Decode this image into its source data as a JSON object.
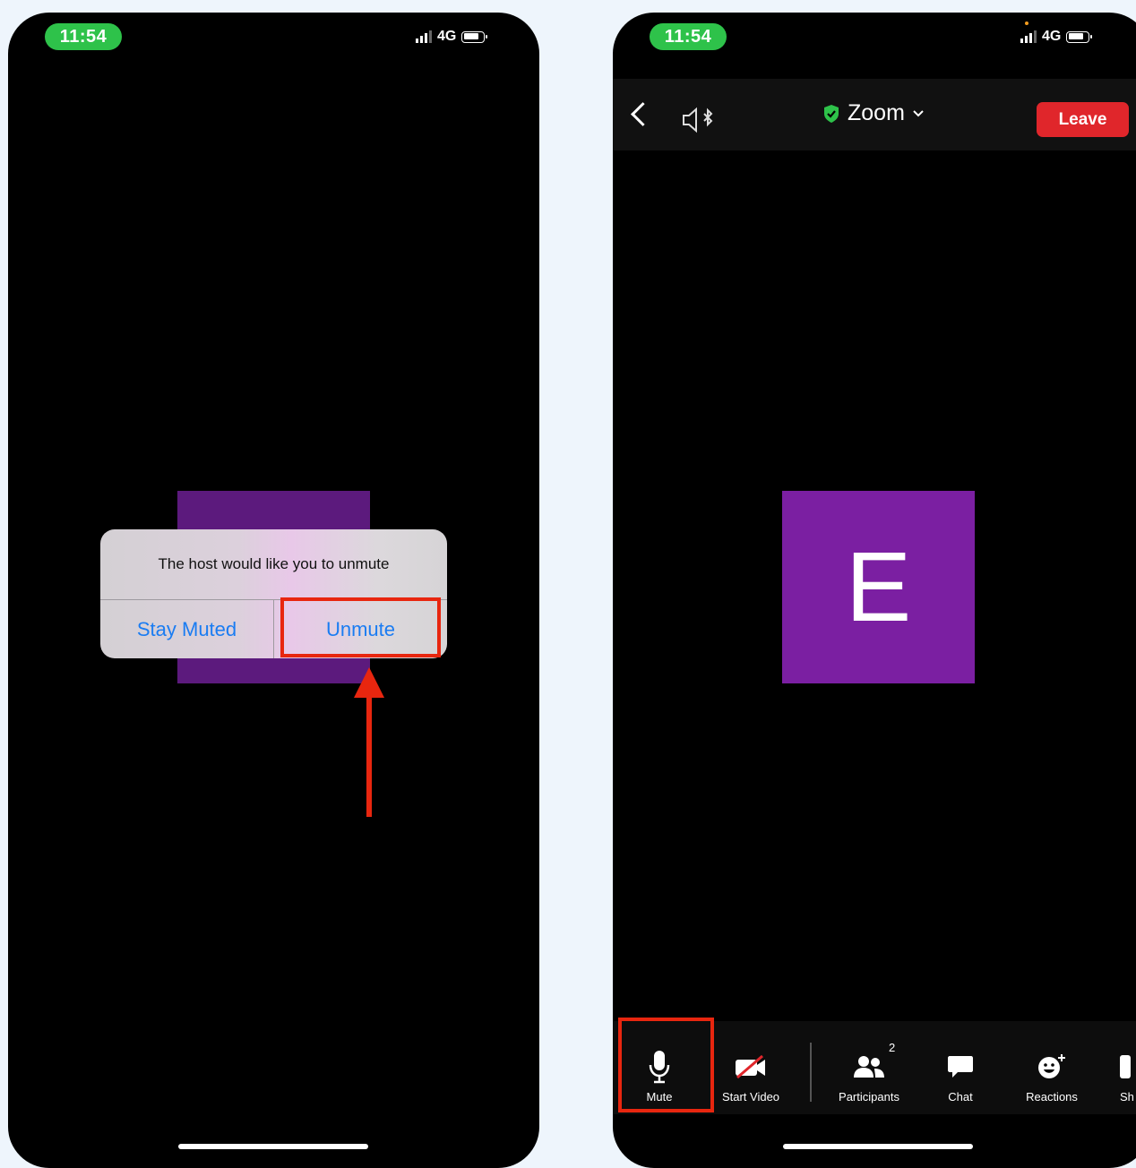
{
  "left_phone": {
    "status": {
      "time": "11:54",
      "network": "4G"
    },
    "alert": {
      "message": "The host would like you to unmute",
      "stay_muted_label": "Stay Muted",
      "unmute_label": "Unmute"
    }
  },
  "right_phone": {
    "status": {
      "time": "11:54",
      "network": "4G"
    },
    "header": {
      "title": "Zoom",
      "leave_label": "Leave"
    },
    "participant_avatar_letter": "E",
    "toolbar": {
      "mute_label": "Mute",
      "start_video_label": "Start Video",
      "participants_label": "Participants",
      "participants_count": "2",
      "chat_label": "Chat",
      "reactions_label": "Reactions",
      "share_label": "Sh"
    }
  },
  "colors": {
    "highlight": "#e8260f",
    "status_pill": "#2ec24a",
    "leave_button": "#e0262b",
    "avatar": "#7b1fa2",
    "ios_link": "#1a7cf2"
  }
}
